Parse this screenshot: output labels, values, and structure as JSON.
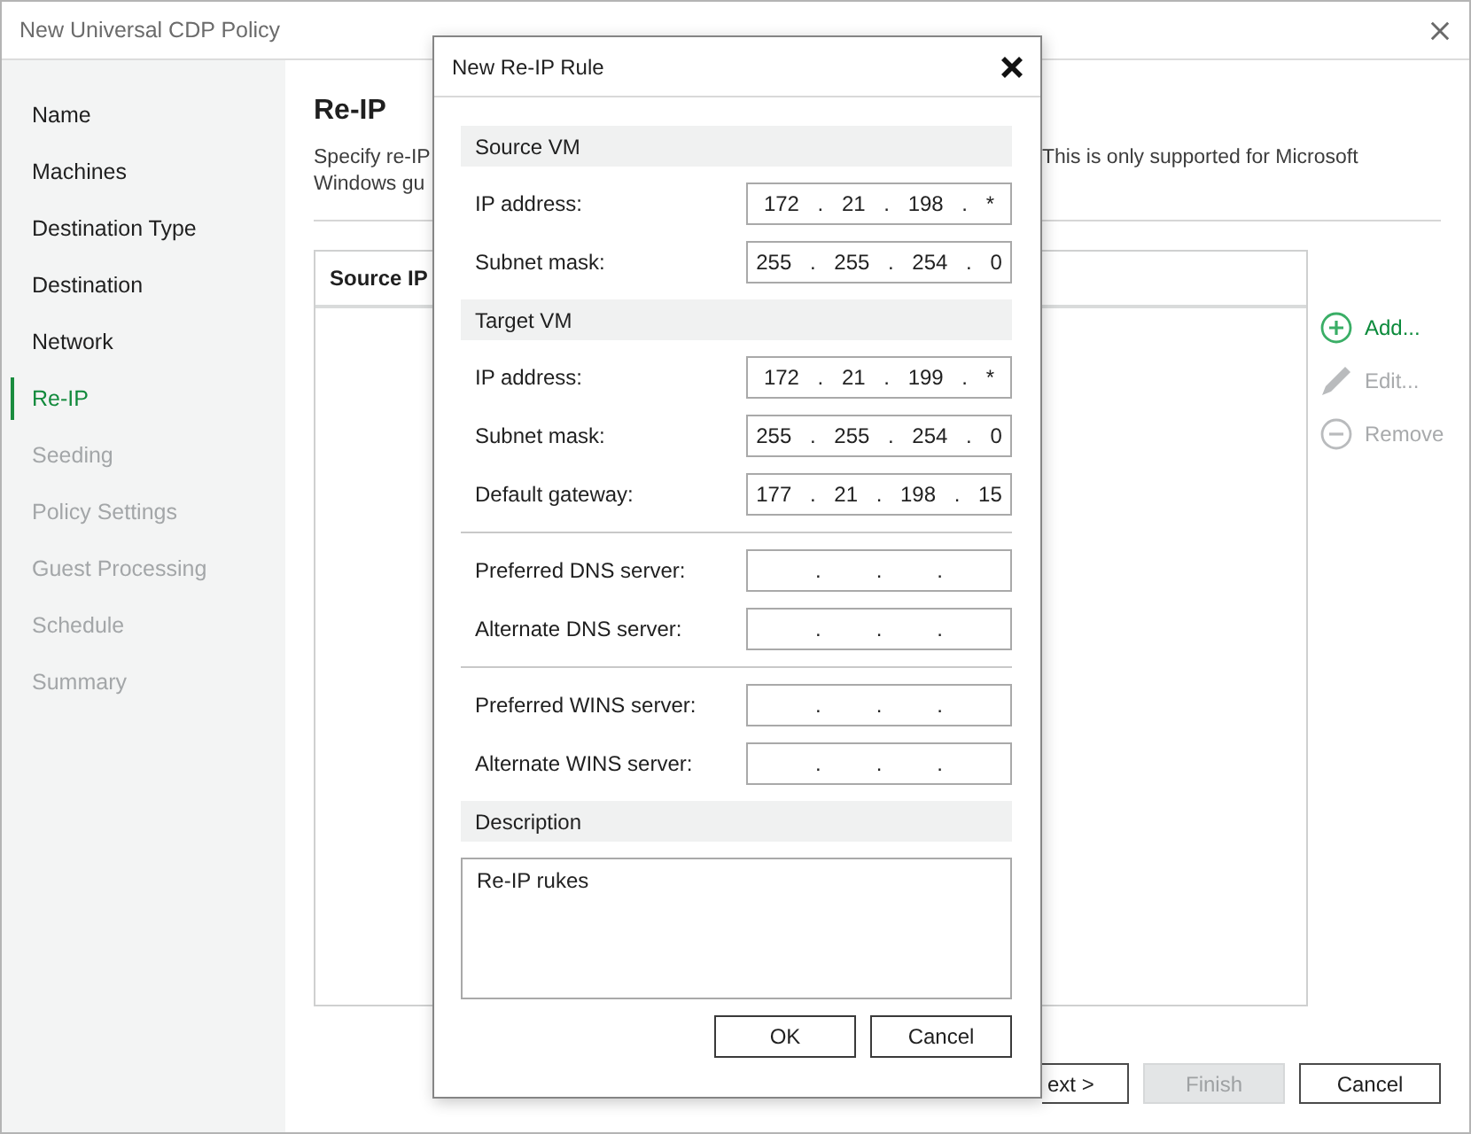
{
  "window": {
    "title": "New Universal CDP Policy"
  },
  "steps": [
    {
      "label": "Name",
      "selected": false,
      "disabled": false
    },
    {
      "label": "Machines",
      "selected": false,
      "disabled": false
    },
    {
      "label": "Destination Type",
      "selected": false,
      "disabled": false
    },
    {
      "label": "Destination",
      "selected": false,
      "disabled": false
    },
    {
      "label": "Network",
      "selected": false,
      "disabled": false
    },
    {
      "label": "Re-IP",
      "selected": true,
      "disabled": false
    },
    {
      "label": "Seeding",
      "selected": false,
      "disabled": true
    },
    {
      "label": "Policy Settings",
      "selected": false,
      "disabled": true
    },
    {
      "label": "Guest Processing",
      "selected": false,
      "disabled": true
    },
    {
      "label": "Schedule",
      "selected": false,
      "disabled": true
    },
    {
      "label": "Summary",
      "selected": false,
      "disabled": true
    }
  ],
  "page": {
    "heading": "Re-IP",
    "description": [
      {
        "start": "Specify re-IP",
        "end": "This is only supported for Microsoft"
      },
      {
        "start": "Windows gu"
      }
    ]
  },
  "table": {
    "columns": [
      "Source IP"
    ]
  },
  "actions": [
    {
      "kind": "add",
      "label": "Add...",
      "disabled": false
    },
    {
      "kind": "edit",
      "label": "Edit...",
      "disabled": true
    },
    {
      "kind": "remove",
      "label": "Remove",
      "disabled": true
    }
  ],
  "footer_buttons": [
    {
      "kind": "clipped",
      "label": "ext >",
      "disabled": false
    },
    {
      "kind": "full",
      "label": "Finish",
      "disabled": true
    },
    {
      "kind": "full",
      "label": "Cancel",
      "disabled": false
    }
  ],
  "dialog": {
    "title": "New Re-IP Rule",
    "groups": [
      {
        "title": "Source VM",
        "fields": [
          {
            "label": "IP address:",
            "value": "172 . 21 . 198 . *"
          },
          {
            "label": "Subnet mask:",
            "value": "255 . 255 . 254 . 0"
          }
        ]
      },
      {
        "title": "Target VM",
        "fields": [
          {
            "label": "IP address:",
            "value": "172 . 21 . 199 . *"
          },
          {
            "label": "Subnet mask:",
            "value": "255 . 255 . 254 . 0"
          },
          {
            "label": "Default gateway:",
            "value": "177 . 21 . 198 . 15"
          }
        ]
      },
      {
        "fields": [
          {
            "label": "Preferred DNS server:",
            "value": ".   .   ."
          },
          {
            "label": "Alternate DNS server:",
            "value": ".   .   ."
          }
        ]
      },
      {
        "fields": [
          {
            "label": "Preferred WINS server:",
            "value": ".   .   ."
          },
          {
            "label": "Alternate WINS server:",
            "value": ".   .   ."
          }
        ]
      }
    ],
    "description": {
      "title": "Description",
      "value": "Re-IP rukes"
    },
    "buttons": [
      "OK",
      "Cancel"
    ]
  }
}
